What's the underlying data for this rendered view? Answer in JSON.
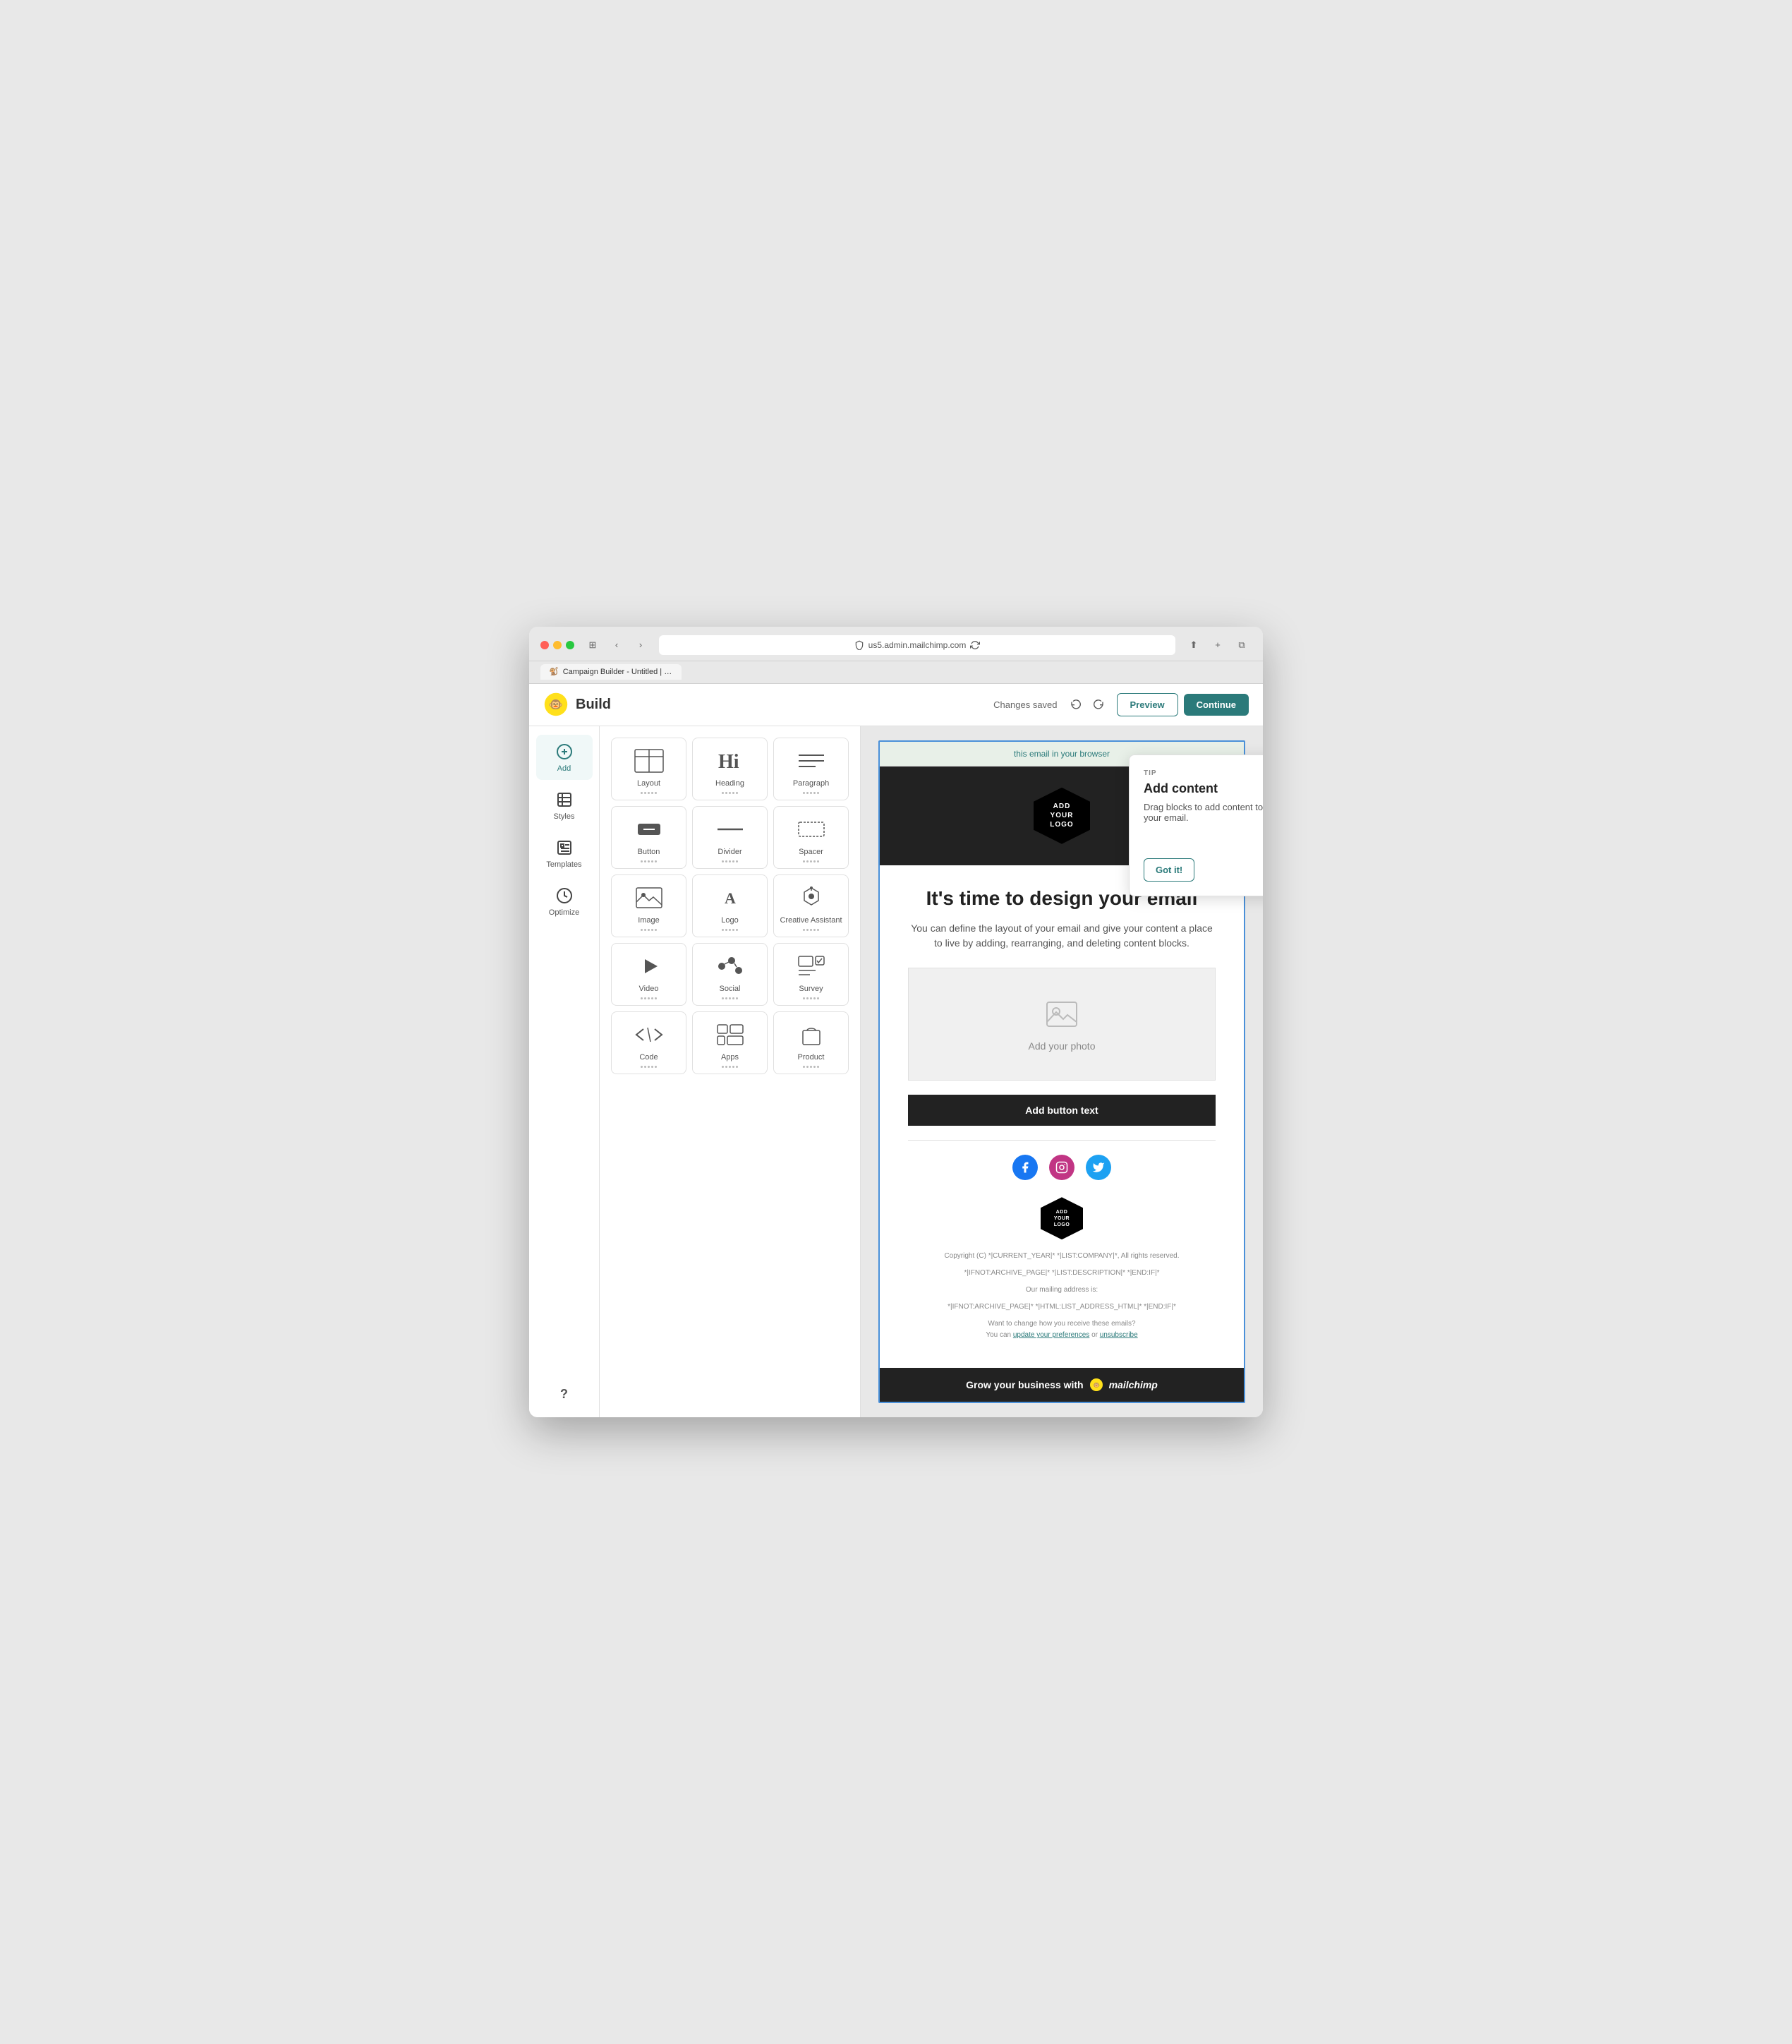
{
  "browser": {
    "traffic_lights": [
      "red",
      "yellow",
      "green"
    ],
    "url": "us5.admin.mailchimp.com",
    "tab_title": "Campaign Builder - Untitled | Mailchimp"
  },
  "topbar": {
    "title": "Build",
    "changes_saved": "Changes saved",
    "preview_label": "Preview",
    "continue_label": "Continue"
  },
  "sidebar": {
    "items": [
      {
        "id": "add",
        "label": "Add",
        "icon": "plus-circle"
      },
      {
        "id": "styles",
        "label": "Styles",
        "icon": "styles"
      },
      {
        "id": "templates",
        "label": "Templates",
        "icon": "templates"
      },
      {
        "id": "optimize",
        "label": "Optimize",
        "icon": "optimize"
      }
    ]
  },
  "blocks": [
    {
      "id": "layout",
      "label": "Layout",
      "icon": "layout"
    },
    {
      "id": "heading",
      "label": "Heading",
      "icon": "heading"
    },
    {
      "id": "paragraph",
      "label": "Paragraph",
      "icon": "paragraph"
    },
    {
      "id": "button",
      "label": "Button",
      "icon": "button"
    },
    {
      "id": "divider",
      "label": "Divider",
      "icon": "divider"
    },
    {
      "id": "spacer",
      "label": "Spacer",
      "icon": "spacer"
    },
    {
      "id": "image",
      "label": "Image",
      "icon": "image"
    },
    {
      "id": "logo",
      "label": "Logo",
      "icon": "logo"
    },
    {
      "id": "creative_assistant",
      "label": "Creative Assistant",
      "icon": "creative-assistant"
    },
    {
      "id": "video",
      "label": "Video",
      "icon": "video"
    },
    {
      "id": "social",
      "label": "Social",
      "icon": "social"
    },
    {
      "id": "survey",
      "label": "Survey",
      "icon": "survey"
    },
    {
      "id": "code",
      "label": "Code",
      "icon": "code"
    },
    {
      "id": "apps",
      "label": "Apps",
      "icon": "apps"
    },
    {
      "id": "product",
      "label": "Product",
      "icon": "product"
    }
  ],
  "tip_popup": {
    "label": "TIP",
    "title": "Add content",
    "body": "Drag blocks to add content to your email.",
    "got_it": "Got it!"
  },
  "email": {
    "header_link_text": "this email in your browser",
    "logo_text": "ADD YOUR LOGO",
    "main_title": "It's time to design your email",
    "subtitle": "You can define the layout of your email and give your content a place to live by adding, rearranging, and deleting content blocks.",
    "add_photo_label": "Add your photo",
    "button_text": "Add button text",
    "social_icons": [
      "facebook",
      "instagram",
      "twitter"
    ],
    "footer_logo_text": "ADD YOUR LOGO",
    "footer_copyright": "Copyright (C) *|CURRENT_YEAR|* *|LIST:COMPANY|*, All rights reserved.",
    "footer_archive": "*|IFNOT:ARCHIVE_PAGE|* *|LIST:DESCRIPTION|* *|END:IF|*",
    "footer_mailing": "Our mailing address is:",
    "footer_address": "*|IFNOT:ARCHIVE_PAGE|* *|HTML:LIST_ADDRESS_HTML|* *|END:IF|*",
    "footer_change": "Want to change how you receive these emails?",
    "footer_preferences": "update your preferences",
    "footer_or": "or",
    "footer_unsubscribe": "unsubscribe",
    "footer_you_can": "You can",
    "mailchimp_badge": "Grow your business with  mailchimp"
  },
  "colors": {
    "teal": "#2b7a7a",
    "dark": "#222222",
    "border_blue": "#4a90d9"
  }
}
